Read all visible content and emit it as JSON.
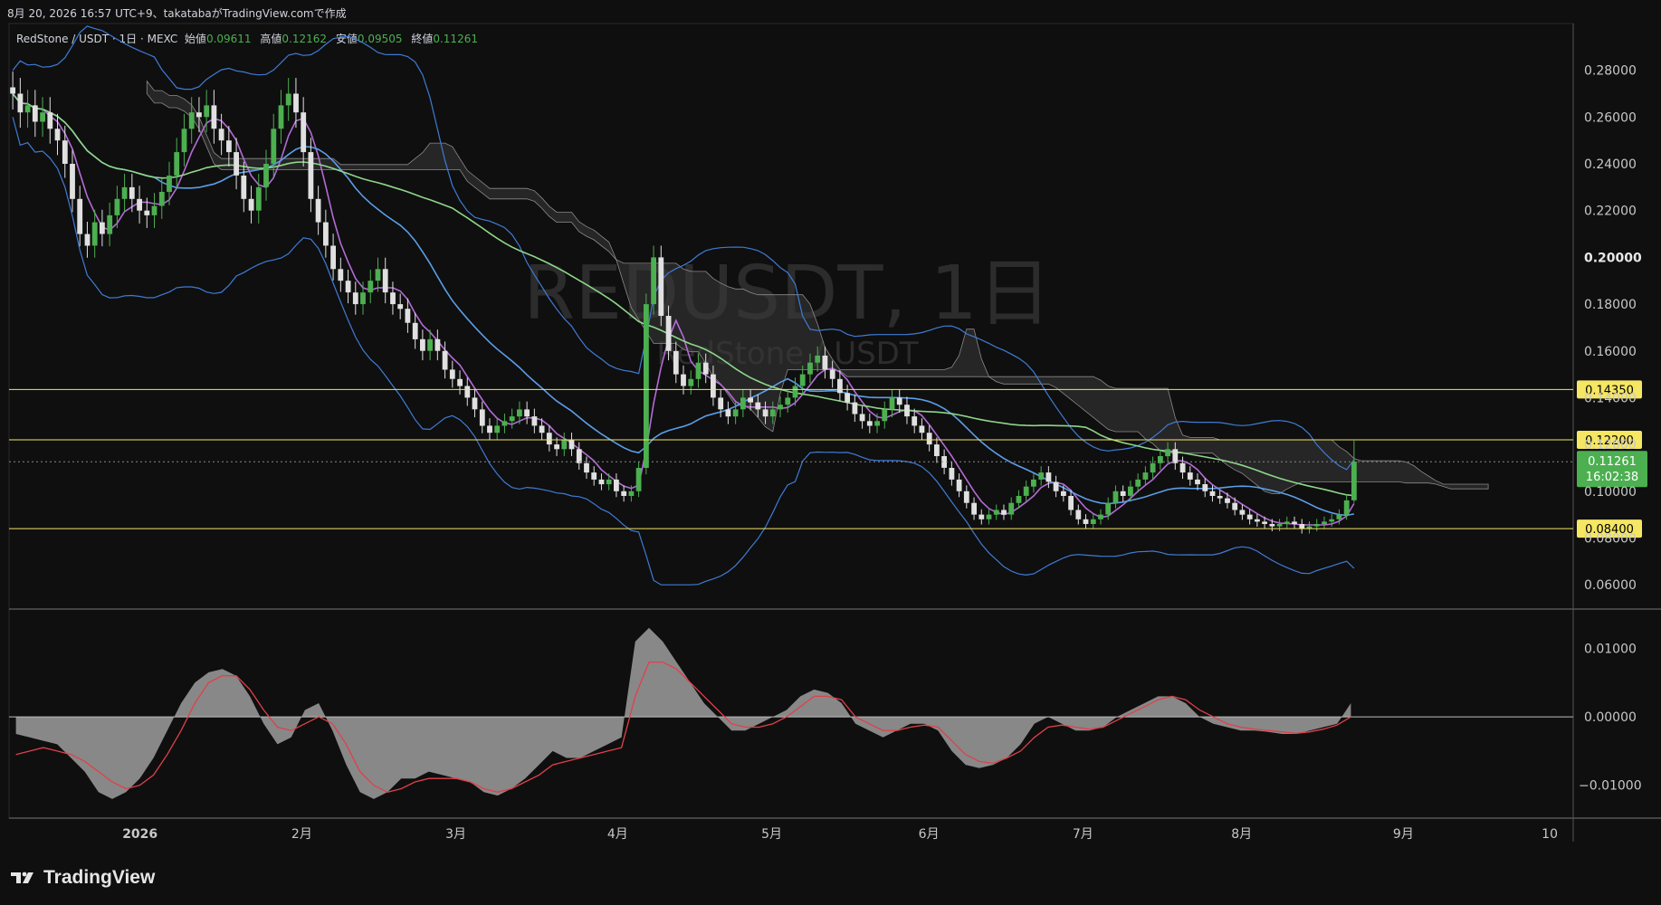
{
  "header": {
    "timestamp_line": "8月 20, 2026 16:57 UTC+9、takatabaがTradingView.comで作成"
  },
  "legend": {
    "symbol_line": "RedStone / USDT · 1日 · MEXC",
    "open_label": "始値",
    "open_value": "0.09611",
    "high_label": "高値",
    "high_value": "0.12162",
    "low_label": "安値",
    "low_value": "0.09505",
    "close_label": "終値",
    "close_value": "0.11261"
  },
  "watermark": {
    "symbol": "REDUSDT, 1日",
    "name": "RedStone / USDT"
  },
  "brand": {
    "name": "TradingView"
  },
  "colors": {
    "background": "#0f0f0f",
    "up": "#4caf50",
    "down": "#e0e0e0",
    "horizontal_line": "#f5e663",
    "price_label_bg": "#f5e663",
    "last_price_bg": "#4caf50",
    "bollinger": "#3f7bd6",
    "sma_fast": "#b46bd6",
    "sma_mid": "#5b9ee8",
    "sma_slow": "#8fd68a",
    "macd_signal": "#e0404a",
    "macd_hist": "#9e9e9e",
    "cloud": "#3a3a3a"
  },
  "chart_data": [
    {
      "type": "candlestick",
      "title": "REDUSDT, 1日",
      "ylabel": "",
      "ylim": [
        0.05,
        0.3
      ],
      "y_ticks": [
        "0.28000",
        "0.26000",
        "0.24000",
        "0.22000",
        "0.20000",
        "0.18000",
        "0.16000",
        "0.14000",
        "0.12000",
        "0.10000",
        "0.08000",
        "0.06000"
      ],
      "x_labels": [
        "2026",
        "2月",
        "3月",
        "4月",
        "5月",
        "6月",
        "7月",
        "8月",
        "9月",
        "10"
      ],
      "horizontal_levels": [
        {
          "value": 0.1435,
          "label": "0.14350"
        },
        {
          "value": 0.122,
          "label": "0.12200"
        },
        {
          "value": 0.084,
          "label": "0.08400"
        }
      ],
      "last_price": {
        "value": 0.11261,
        "label": "0.11261",
        "countdown": "16:02:38"
      },
      "ohlc_last": {
        "open": 0.09611,
        "high": 0.12162,
        "low": 0.09505,
        "close": 0.11261
      },
      "closes": [
        0.27,
        0.262,
        0.265,
        0.258,
        0.262,
        0.255,
        0.25,
        0.24,
        0.225,
        0.21,
        0.205,
        0.215,
        0.21,
        0.218,
        0.225,
        0.23,
        0.225,
        0.22,
        0.218,
        0.222,
        0.228,
        0.235,
        0.245,
        0.255,
        0.262,
        0.26,
        0.265,
        0.255,
        0.25,
        0.245,
        0.235,
        0.225,
        0.22,
        0.23,
        0.24,
        0.255,
        0.265,
        0.27,
        0.262,
        0.245,
        0.225,
        0.215,
        0.205,
        0.195,
        0.19,
        0.185,
        0.18,
        0.185,
        0.19,
        0.195,
        0.185,
        0.18,
        0.178,
        0.172,
        0.165,
        0.16,
        0.165,
        0.16,
        0.152,
        0.148,
        0.145,
        0.14,
        0.135,
        0.128,
        0.125,
        0.128,
        0.13,
        0.132,
        0.135,
        0.132,
        0.128,
        0.125,
        0.12,
        0.118,
        0.122,
        0.118,
        0.112,
        0.108,
        0.105,
        0.103,
        0.105,
        0.1,
        0.098,
        0.1,
        0.11,
        0.18,
        0.2,
        0.175,
        0.16,
        0.15,
        0.145,
        0.148,
        0.155,
        0.15,
        0.14,
        0.135,
        0.132,
        0.135,
        0.14,
        0.138,
        0.135,
        0.132,
        0.135,
        0.137,
        0.14,
        0.145,
        0.15,
        0.155,
        0.158,
        0.152,
        0.148,
        0.142,
        0.138,
        0.133,
        0.13,
        0.128,
        0.13,
        0.135,
        0.14,
        0.137,
        0.132,
        0.128,
        0.125,
        0.12,
        0.115,
        0.11,
        0.105,
        0.1,
        0.095,
        0.09,
        0.088,
        0.09,
        0.092,
        0.09,
        0.095,
        0.098,
        0.102,
        0.105,
        0.108,
        0.104,
        0.1,
        0.098,
        0.092,
        0.088,
        0.086,
        0.088,
        0.09,
        0.095,
        0.1,
        0.098,
        0.102,
        0.105,
        0.108,
        0.112,
        0.115,
        0.118,
        0.112,
        0.108,
        0.105,
        0.103,
        0.1,
        0.098,
        0.097,
        0.095,
        0.092,
        0.09,
        0.088,
        0.087,
        0.086,
        0.085,
        0.086,
        0.087,
        0.086,
        0.084,
        0.085,
        0.086,
        0.087,
        0.088,
        0.09,
        0.09611,
        0.11261
      ]
    },
    {
      "type": "area",
      "title": "",
      "ylim": [
        -0.014,
        0.0135
      ],
      "y_ticks": [
        "0.01000",
        "0.00000",
        "−0.01000"
      ],
      "macd_hist": [
        -0.0025,
        -0.003,
        -0.0035,
        -0.004,
        -0.006,
        -0.008,
        -0.011,
        -0.012,
        -0.011,
        -0.009,
        -0.006,
        -0.002,
        0.002,
        0.005,
        0.0065,
        0.007,
        0.006,
        0.003,
        -0.001,
        -0.004,
        -0.003,
        0.001,
        0.002,
        -0.002,
        -0.007,
        -0.011,
        -0.012,
        -0.011,
        -0.009,
        -0.009,
        -0.008,
        -0.0085,
        -0.009,
        -0.0095,
        -0.011,
        -0.0115,
        -0.0105,
        -0.009,
        -0.007,
        -0.005,
        -0.006,
        -0.006,
        -0.005,
        -0.004,
        -0.003,
        0.011,
        0.013,
        0.011,
        0.008,
        0.005,
        0.002,
        0.0,
        -0.002,
        -0.002,
        -0.001,
        0.0,
        0.001,
        0.003,
        0.004,
        0.0035,
        0.002,
        -0.001,
        -0.002,
        -0.003,
        -0.002,
        -0.001,
        -0.001,
        -0.002,
        -0.005,
        -0.007,
        -0.0075,
        -0.007,
        -0.006,
        -0.004,
        -0.001,
        0.0,
        -0.001,
        -0.002,
        -0.002,
        -0.0015,
        0.0,
        0.001,
        0.002,
        0.003,
        0.003,
        0.002,
        0.0,
        -0.001,
        -0.0015,
        -0.002,
        -0.002,
        -0.0022,
        -0.0025,
        -0.0025,
        -0.002,
        -0.0015,
        -0.001,
        0.002
      ],
      "macd_signal": [
        -0.0055,
        -0.005,
        -0.0045,
        -0.005,
        -0.0055,
        -0.0065,
        -0.008,
        -0.0095,
        -0.0105,
        -0.01,
        -0.0085,
        -0.0055,
        -0.002,
        0.002,
        0.005,
        0.006,
        0.006,
        0.004,
        0.001,
        -0.0015,
        -0.002,
        -0.001,
        0.0,
        -0.001,
        -0.004,
        -0.008,
        -0.01,
        -0.011,
        -0.0105,
        -0.0095,
        -0.009,
        -0.009,
        -0.009,
        -0.0095,
        -0.0105,
        -0.011,
        -0.0105,
        -0.0095,
        -0.0085,
        -0.007,
        -0.0065,
        -0.006,
        -0.0055,
        -0.005,
        -0.0045,
        0.003,
        0.008,
        0.008,
        0.007,
        0.005,
        0.003,
        0.001,
        -0.001,
        -0.0015,
        -0.0015,
        -0.001,
        0.0,
        0.0015,
        0.003,
        0.003,
        0.0025,
        0.0,
        -0.001,
        -0.002,
        -0.002,
        -0.0015,
        -0.0012,
        -0.0015,
        -0.0035,
        -0.0055,
        -0.0065,
        -0.0068,
        -0.006,
        -0.005,
        -0.003,
        -0.0015,
        -0.0012,
        -0.0015,
        -0.0018,
        -0.0015,
        -0.0005,
        0.0005,
        0.0015,
        0.0025,
        0.003,
        0.0025,
        0.001,
        0.0,
        -0.001,
        -0.0015,
        -0.0018,
        -0.002,
        -0.0022,
        -0.0024,
        -0.0022,
        -0.0018,
        -0.0012,
        0.0
      ]
    }
  ]
}
